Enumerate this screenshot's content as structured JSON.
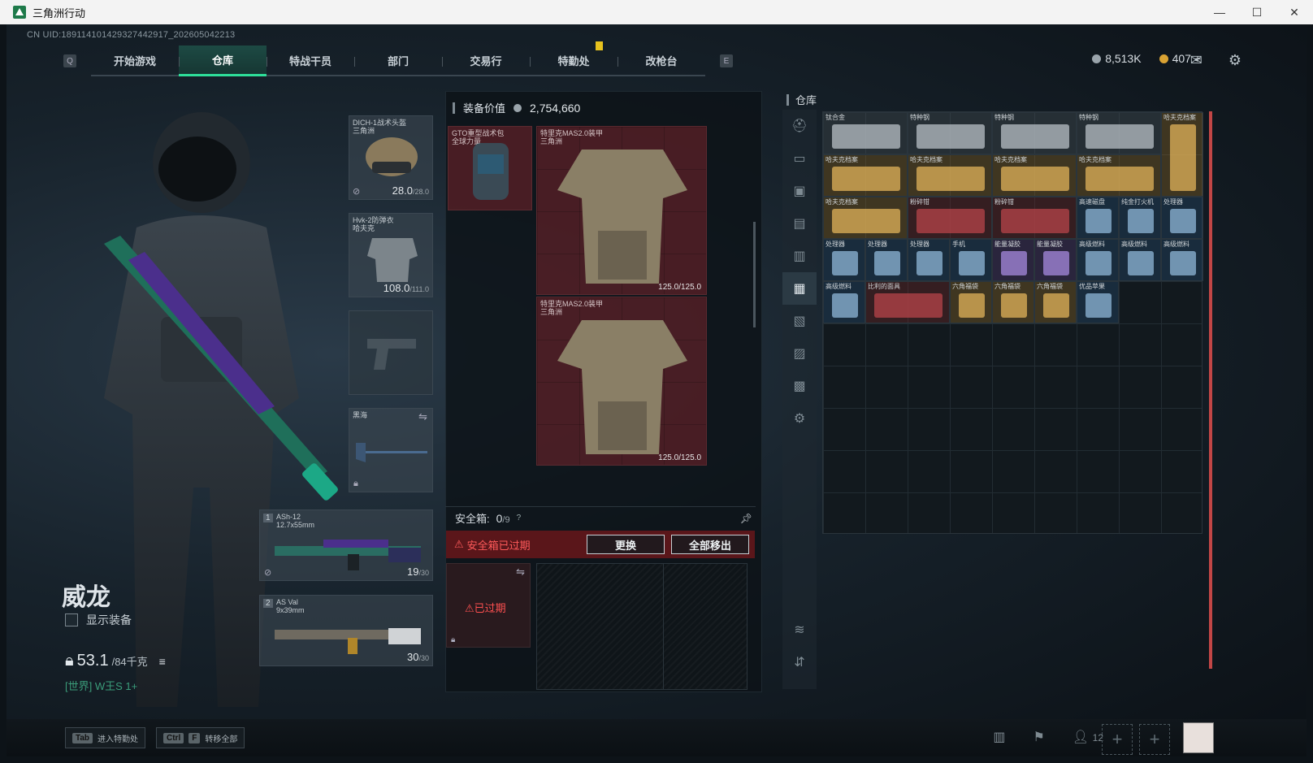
{
  "window": {
    "title": "三角洲行动",
    "controls": [
      "—",
      "☐",
      "✕"
    ]
  },
  "uid": "CN UID:189114101429327442917_202605042213",
  "nav": {
    "left_key": "Q",
    "right_key": "E",
    "tabs": [
      {
        "label": "开始游戏"
      },
      {
        "label": "仓库",
        "active": true
      },
      {
        "label": "特战干员"
      },
      {
        "label": "部门"
      },
      {
        "label": "交易行"
      },
      {
        "label": "特勤处"
      },
      {
        "label": "改枪台"
      }
    ]
  },
  "currency": {
    "silver": "8,513K",
    "gold": "407",
    "gold_plus": "+"
  },
  "character": {
    "name": "威龙",
    "show_gear_label": "显示装备",
    "weight_value": "53.1",
    "weight_max": "/84千克",
    "channel": "[世界] W王S",
    "channel_suffix": "1+"
  },
  "equipment": {
    "helmet": {
      "label": "DICH-1战术头盔\n三角洲",
      "value": "28.0",
      "max": "/28.0"
    },
    "armor": {
      "label": "Hvk-2防弹衣\n哈夫克",
      "value": "108.0",
      "max": "/111.0"
    },
    "melee": {
      "label": "黑海"
    },
    "weapon1": {
      "num": "1",
      "name": "ASh-12",
      "caliber": "12.7x55mm",
      "ammo": "19",
      "ammo_max": "/30"
    },
    "weapon2": {
      "num": "2",
      "name": "AS Val",
      "caliber": "9x39mm",
      "ammo": "30",
      "ammo_max": "/30"
    }
  },
  "loadout": {
    "header_label": "装备价值",
    "header_value": "2,754,660",
    "backpack_label": "GTO重型战术包\n全球力量",
    "armor_a_label": "特里克MAS2.0装甲\n三角洲",
    "armor_a_value": "125.0/125.0",
    "armor_b_label": "特里克MAS2.0装甲\n三角洲",
    "armor_b_value": "125.0/125.0"
  },
  "safebox": {
    "label": "安全箱:",
    "count": "0",
    "max": "/9",
    "help": "?",
    "expired_msg": "安全箱已过期",
    "replace_btn": "更换",
    "remove_all_btn": "全部移出",
    "case_status": "已过期"
  },
  "warehouse": {
    "title": "仓库",
    "items": [
      {
        "label": "钛合金",
        "c": 0,
        "r": 0,
        "w": 2,
        "color": "grey"
      },
      {
        "label": "特种钢",
        "c": 2,
        "r": 0,
        "w": 2,
        "color": "grey"
      },
      {
        "label": "特种钢",
        "c": 4,
        "r": 0,
        "w": 2,
        "color": "grey"
      },
      {
        "label": "特种钢",
        "c": 6,
        "r": 0,
        "w": 2,
        "color": "grey"
      },
      {
        "label": "哈夫克档案",
        "c": 8,
        "r": 0,
        "w": 1,
        "h": 2,
        "color": "gold"
      },
      {
        "label": "哈夫克档案",
        "c": 0,
        "r": 1,
        "w": 2,
        "color": "gold"
      },
      {
        "label": "哈夫克档案",
        "c": 2,
        "r": 1,
        "w": 2,
        "color": "gold"
      },
      {
        "label": "哈夫克档案",
        "c": 4,
        "r": 1,
        "w": 2,
        "color": "gold"
      },
      {
        "label": "哈夫克档案",
        "c": 6,
        "r": 1,
        "w": 2,
        "color": "gold"
      },
      {
        "label": "哈夫克档案",
        "c": 0,
        "r": 2,
        "w": 2,
        "color": "gold"
      },
      {
        "label": "粉碎钳",
        "c": 2,
        "r": 2,
        "w": 2,
        "color": "red"
      },
      {
        "label": "粉碎钳",
        "c": 4,
        "r": 2,
        "w": 2,
        "color": "red"
      },
      {
        "label": "高速磁盘",
        "c": 6,
        "r": 2,
        "w": 1,
        "color": "blue"
      },
      {
        "label": "纯金打火机",
        "c": 7,
        "r": 2,
        "w": 1,
        "color": "blue"
      },
      {
        "label": "处理器",
        "c": 8,
        "r": 2,
        "w": 1,
        "color": "blue"
      },
      {
        "label": "处理器",
        "c": 0,
        "r": 3,
        "w": 1,
        "color": "blue"
      },
      {
        "label": "处理器",
        "c": 1,
        "r": 3,
        "w": 1,
        "color": "blue"
      },
      {
        "label": "处理器",
        "c": 2,
        "r": 3,
        "w": 1,
        "color": "blue"
      },
      {
        "label": "手机",
        "c": 3,
        "r": 3,
        "w": 1,
        "color": "blue"
      },
      {
        "label": "能量凝胶",
        "c": 4,
        "r": 3,
        "w": 1,
        "color": "purple"
      },
      {
        "label": "能量凝胶",
        "c": 5,
        "r": 3,
        "w": 1,
        "color": "purple"
      },
      {
        "label": "高级燃料",
        "c": 6,
        "r": 3,
        "w": 1,
        "color": "blue"
      },
      {
        "label": "高级燃料",
        "c": 7,
        "r": 3,
        "w": 1,
        "color": "blue"
      },
      {
        "label": "高级燃料",
        "c": 8,
        "r": 3,
        "w": 1,
        "color": "blue"
      },
      {
        "label": "高级燃料",
        "c": 0,
        "r": 4,
        "w": 1,
        "color": "blue"
      },
      {
        "label": "比利的面具",
        "c": 1,
        "r": 4,
        "w": 2,
        "color": "red"
      },
      {
        "label": "六角福袋",
        "c": 3,
        "r": 4,
        "w": 1,
        "color": "gold"
      },
      {
        "label": "六角福袋",
        "c": 4,
        "r": 4,
        "w": 1,
        "color": "gold"
      },
      {
        "label": "六角福袋",
        "c": 5,
        "r": 4,
        "w": 1,
        "color": "gold"
      },
      {
        "label": "优品苹果",
        "c": 6,
        "r": 4,
        "w": 1,
        "color": "blue"
      }
    ]
  },
  "bottom": {
    "tab_key": "Tab",
    "tab_label": "进入特勤处",
    "ctrl_key": "Ctrl",
    "f_key": "F",
    "transfer_label": "转移全部",
    "team_count": "12"
  }
}
